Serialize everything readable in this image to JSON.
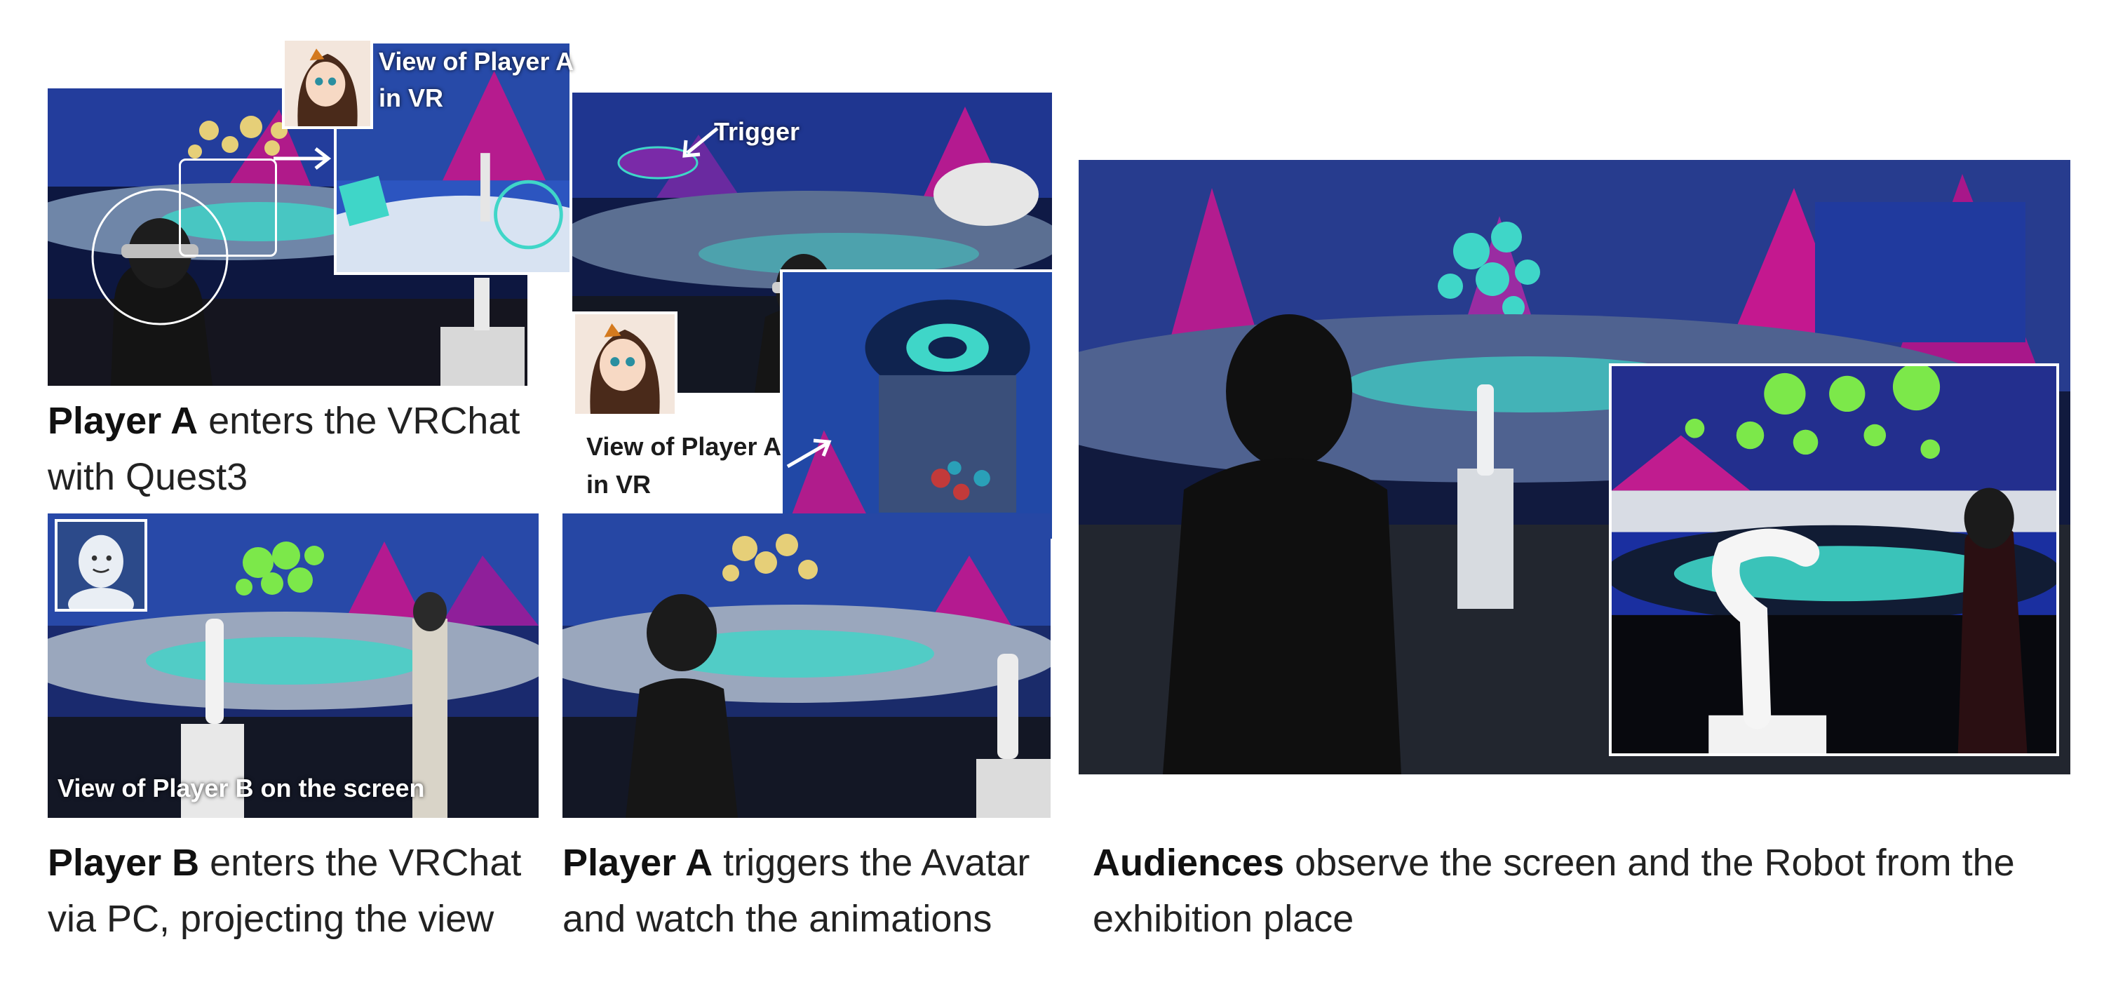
{
  "panel1": {
    "inset_label_line1": "View of Player A",
    "inset_label_line2": "in VR",
    "caption_bold": "Player A",
    "caption_rest_line1": " enters the VRChat",
    "caption_line2": "with Quest3"
  },
  "panel2": {
    "trigger_label": "Trigger",
    "inset_label_line1": "View of Player A",
    "inset_label_line2": "in VR",
    "caption_bold": "Player A",
    "caption_rest_line1": " triggers the Avatar",
    "caption_line2": "and watch the animations"
  },
  "panel3": {
    "overlay_label": "View of Player B on the screen",
    "caption_bold": "Player B",
    "caption_rest_line1": " enters the VRChat",
    "caption_line2": "via PC, projecting the view"
  },
  "panel4": {
    "caption_bold": "Audiences",
    "caption_rest_line1": " observe the screen and the Robot from the",
    "caption_line2": "exhibition place"
  },
  "colors": {
    "scene_dark": "#0b1330",
    "scene_blue": "#2b4fb5",
    "magenta": "#c2188f",
    "teal": "#3fd6c8",
    "green": "#7ce84a"
  }
}
